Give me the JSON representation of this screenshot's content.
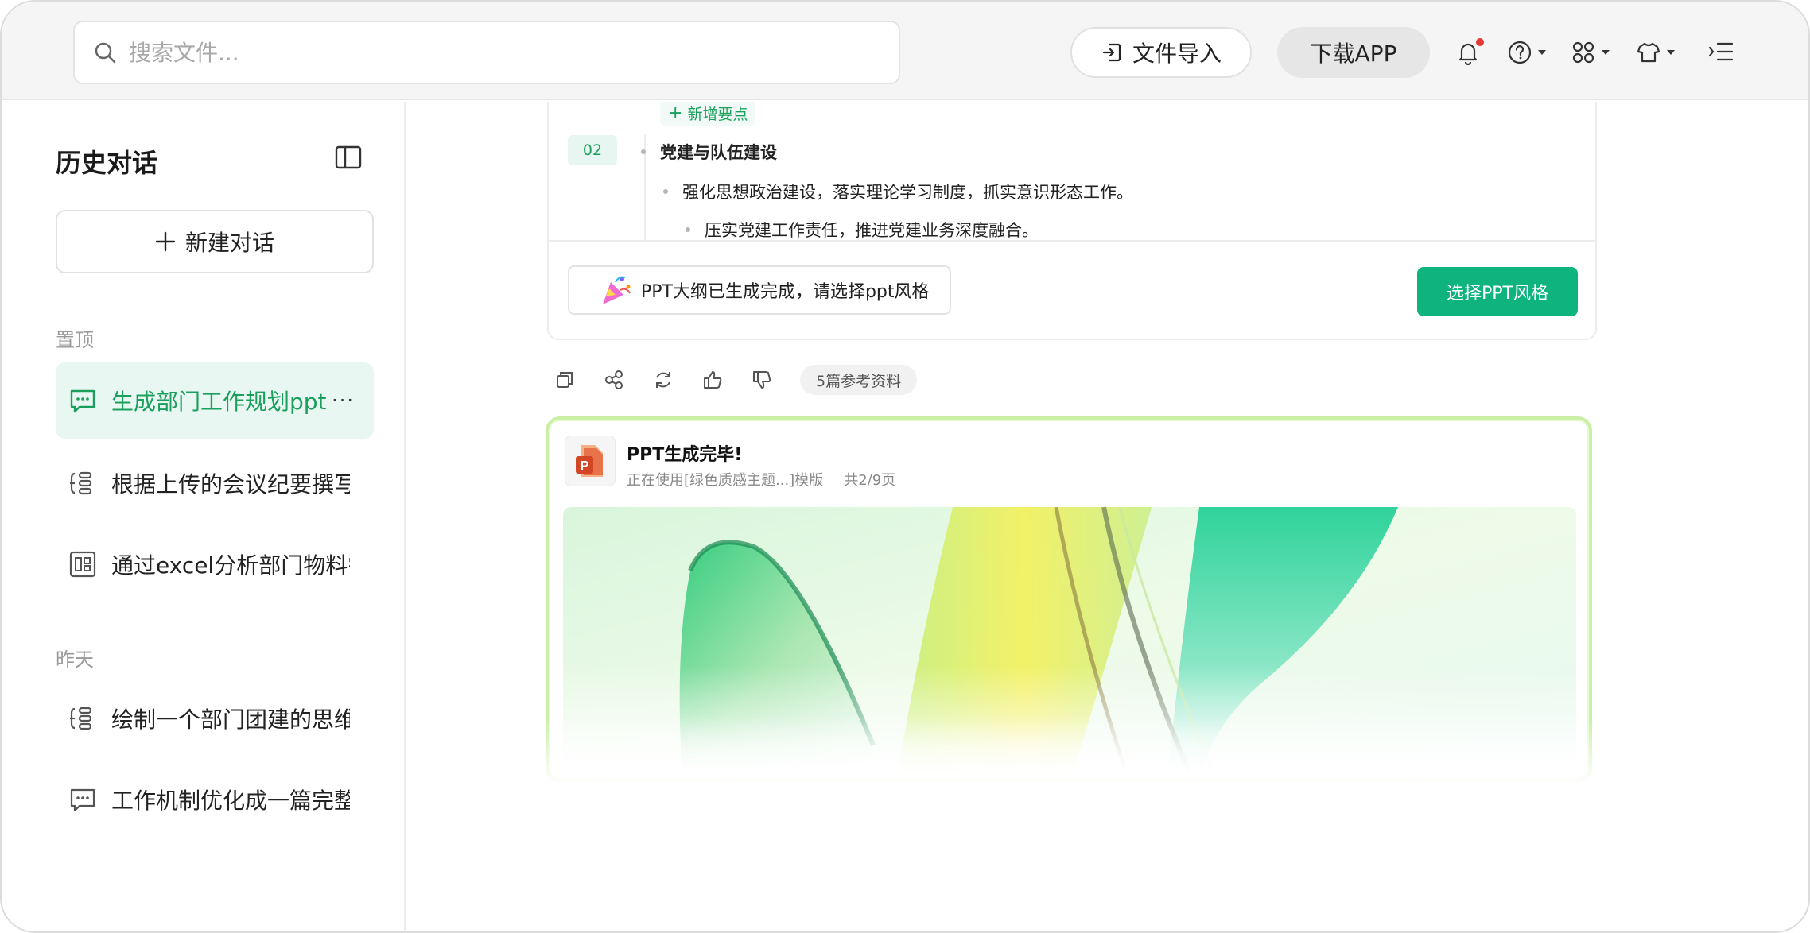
{
  "search": {
    "placeholder": "搜索文件..."
  },
  "toolbar": {
    "import_label": "文件导入",
    "download_label": "下载APP",
    "icons": [
      "bell-icon",
      "help-icon",
      "apps-icon",
      "shirt-icon",
      "expand-menu-icon"
    ]
  },
  "sidebar": {
    "title": "历史对话",
    "new_chat_label": "新建对话",
    "sections": [
      {
        "label": "置顶",
        "items": [
          {
            "label": "生成部门工作规划ppt",
            "icon": "chat-bubble-icon",
            "active": true
          },
          {
            "label": "根据上传的会议纪要撰写...",
            "icon": "mindmap-icon",
            "active": false
          },
          {
            "label": "通过excel分析部门物料需...",
            "icon": "spreadsheet-icon",
            "active": false
          }
        ]
      },
      {
        "label": "昨天",
        "items": [
          {
            "label": "绘制一个部门团建的思维...",
            "icon": "mindmap-icon",
            "active": false
          },
          {
            "label": "工作机制优化成一篇完整...",
            "icon": "chat-bubble-icon",
            "active": false
          }
        ]
      }
    ],
    "more_label": "···"
  },
  "outline": {
    "add_point_label": "新增要点",
    "section_number": "02",
    "section_title": "党建与队伍建设",
    "point_1": "强化思想政治建设，落实理论学习制度，抓实意识形态工作。",
    "point_2": "压实党建工作责任，推进党建业务深度融合。",
    "ready_text": "PPT大纲已生成完成，请选择ppt风格",
    "choose_style_label": "选择PPT风格"
  },
  "actions": {
    "references_label": "5篇参考资料",
    "icons": [
      "copy-icon",
      "share-icon",
      "refresh-icon",
      "thumbs-up-icon",
      "thumbs-down-icon"
    ]
  },
  "ppt_result": {
    "title": "PPT生成完毕!",
    "template_text": "正在使用[绿色质感主题...]模版",
    "pages_text": "共2/9页",
    "file_icon_letter": "P"
  },
  "colors": {
    "accent": "#0fb37d",
    "accent_text": "#1aa05c",
    "active_bg": "#e9f7f3",
    "notification": "#e53935",
    "card_border": "#c9f0a4"
  }
}
